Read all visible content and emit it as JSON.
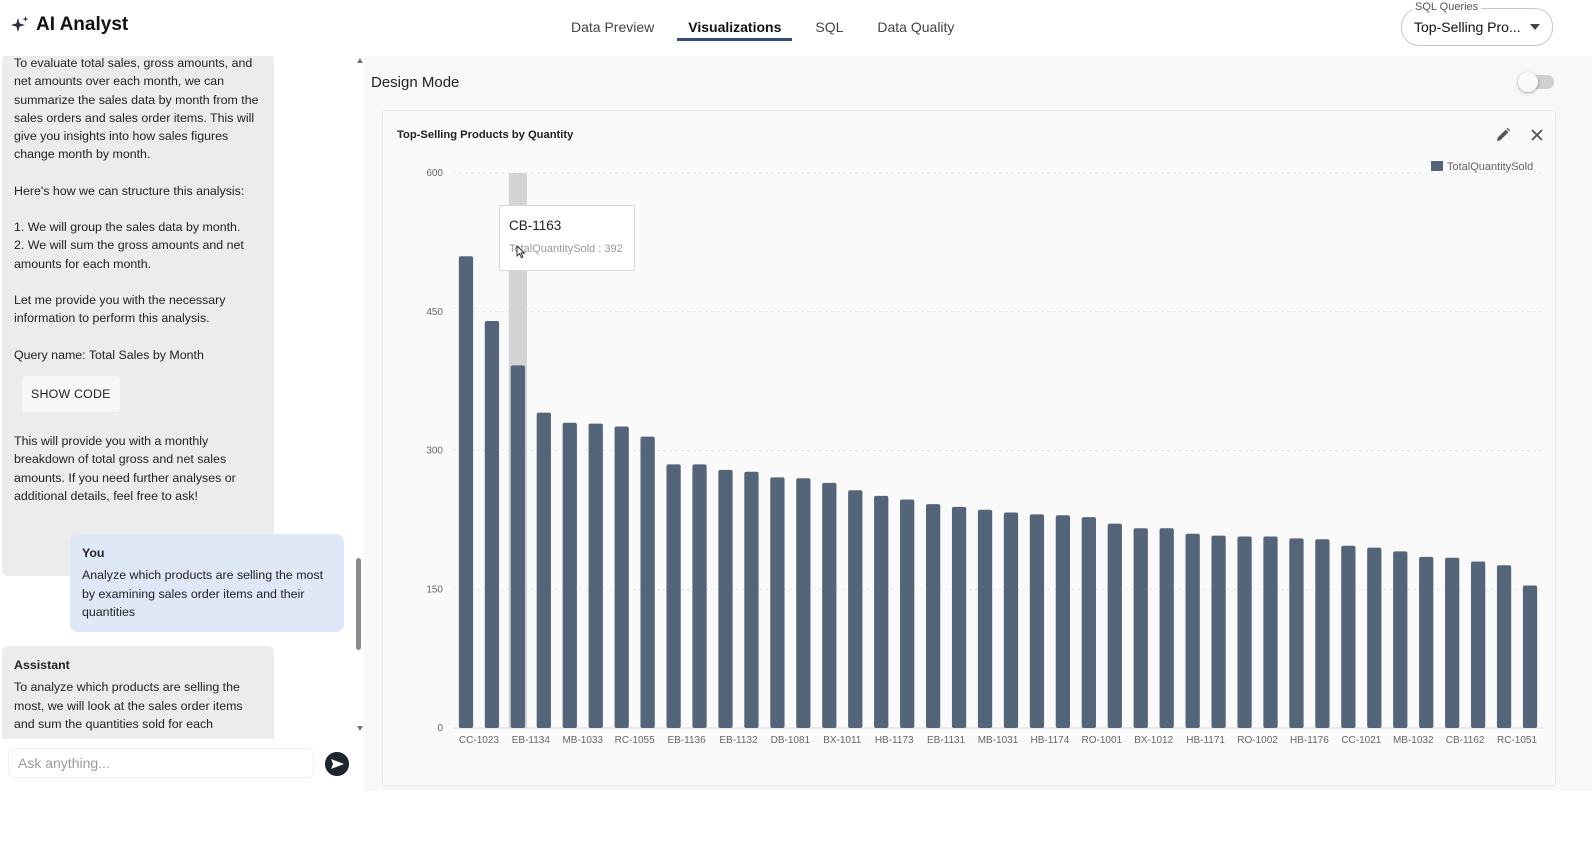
{
  "app": {
    "title": "AI Analyst",
    "colors": {
      "accent": "#2f4f7f",
      "bar": "#546579",
      "highlight": "#d3d3d3"
    }
  },
  "tabs": [
    {
      "label": "Data Preview"
    },
    {
      "label": "Visualizations",
      "active": true
    },
    {
      "label": "SQL"
    },
    {
      "label": "Data Quality"
    }
  ],
  "sql_queries": {
    "label": "SQL Queries",
    "value": "Top-Selling Pro..."
  },
  "chat": {
    "assistant1": {
      "p1": "To evaluate total sales, gross amounts, and net amounts over each month, we can summarize the sales data by month from the sales orders and sales order items. This will give you insights into how sales figures change month by month.",
      "p2": "Here's how we can structure this analysis:",
      "p3a": "1. We will group the sales data by month.",
      "p3b": "2. We will sum the gross amounts and net amounts for each month.",
      "p4": "Let me provide you with the necessary information to perform this analysis.",
      "p5": "Query name: Total Sales by Month",
      "show_code": "SHOW CODE",
      "p6": "This will provide you with a monthly breakdown of total gross and net sales amounts. If you need further analyses or additional details, feel free to ask!"
    },
    "you": {
      "who": "You",
      "text": "Analyze which products are selling the most by examining sales order items and their quantities"
    },
    "assistant2": {
      "who": "Assistant",
      "text": "To analyze which products are selling the most, we will look at the sales order items and sum the quantities sold for each"
    },
    "input_placeholder": "Ask anything..."
  },
  "design_mode": {
    "label": "Design Mode",
    "enabled": false
  },
  "chart_data": {
    "type": "bar",
    "title": "Top-Selling Products by Quantity",
    "legend": "TotalQuantitySold",
    "legend_position": "top-right",
    "ylim": [
      0,
      600
    ],
    "yticks": [
      0,
      150,
      300,
      450,
      600
    ],
    "grid": true,
    "x_tick_labels": [
      "CC-1023",
      "EB-1134",
      "MB-1033",
      "RC-1055",
      "EB-1136",
      "EB-1132",
      "DB-1081",
      "BX-1011",
      "HB-1173",
      "EB-1131",
      "MB-1031",
      "HB-1174",
      "RO-1001",
      "BX-1012",
      "HB-1171",
      "RO-1002",
      "HB-1176",
      "CC-1021",
      "MB-1032",
      "CB-1162",
      "RC-1051"
    ],
    "values": [
      510,
      440,
      392,
      341,
      330,
      329,
      326,
      315,
      285,
      285,
      279,
      277,
      271,
      270,
      265,
      257,
      251,
      247,
      242,
      239,
      236,
      233,
      231,
      230,
      228,
      221,
      216,
      216,
      210,
      208,
      207,
      207,
      205,
      204,
      197,
      195,
      191,
      185,
      184,
      180,
      176,
      154
    ],
    "tooltip": {
      "category": "CB-1163",
      "series": "TotalQuantitySold",
      "value": 392,
      "index": 2
    }
  }
}
